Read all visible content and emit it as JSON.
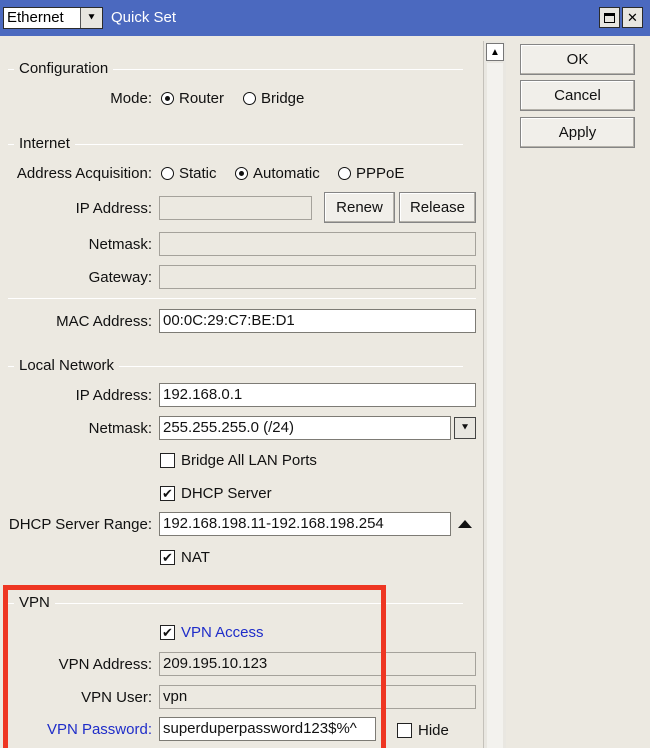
{
  "window": {
    "mode_value": "Ethernet",
    "title": "Quick Set",
    "dropdown_glyph": "⯆",
    "close_glyph": "✕"
  },
  "actions": {
    "ok": "OK",
    "cancel": "Cancel",
    "apply": "Apply"
  },
  "configuration": {
    "section": "Configuration",
    "mode_label": "Mode:",
    "options": [
      {
        "label": "Router",
        "selected": true
      },
      {
        "label": "Bridge",
        "selected": false
      }
    ]
  },
  "internet": {
    "section": "Internet",
    "acquisition_label": "Address Acquisition:",
    "options": [
      {
        "label": "Static",
        "selected": false
      },
      {
        "label": "Automatic",
        "selected": true
      },
      {
        "label": "PPPoE",
        "selected": false
      }
    ],
    "ip_label": "IP Address:",
    "ip_value": "",
    "renew": "Renew",
    "release": "Release",
    "netmask_label": "Netmask:",
    "netmask_value": "",
    "gateway_label": "Gateway:",
    "gateway_value": "",
    "mac_label": "MAC Address:",
    "mac_value": "00:0C:29:C7:BE:D1"
  },
  "local_network": {
    "section": "Local Network",
    "ip_label": "IP Address:",
    "ip_value": "192.168.0.1",
    "netmask_label": "Netmask:",
    "netmask_value": "255.255.255.0 (/24)",
    "bridge_all": {
      "label": "Bridge All LAN Ports",
      "checked": false
    },
    "dhcp_server": {
      "label": "DHCP Server",
      "checked": true
    },
    "dhcp_range_label": "DHCP Server Range:",
    "dhcp_range_value": "192.168.198.11-192.168.198.254",
    "nat": {
      "label": "NAT",
      "checked": true
    }
  },
  "vpn": {
    "section": "VPN",
    "access": {
      "label": "VPN Access",
      "checked": true
    },
    "address_label": "VPN Address:",
    "address_value": "209.195.10.123",
    "user_label": "VPN User:",
    "user_value": "vpn",
    "password_label": "VPN Password:",
    "password_value": "superduperpassword123$%^",
    "hide": {
      "label": "Hide",
      "checked": false
    }
  },
  "check_mark": "✔",
  "colors": {
    "titlebar": "#4b69bf",
    "highlight": "#ee3622",
    "link_blue": "#1f2dc9"
  },
  "icons": {
    "scroll_up": "▲"
  }
}
